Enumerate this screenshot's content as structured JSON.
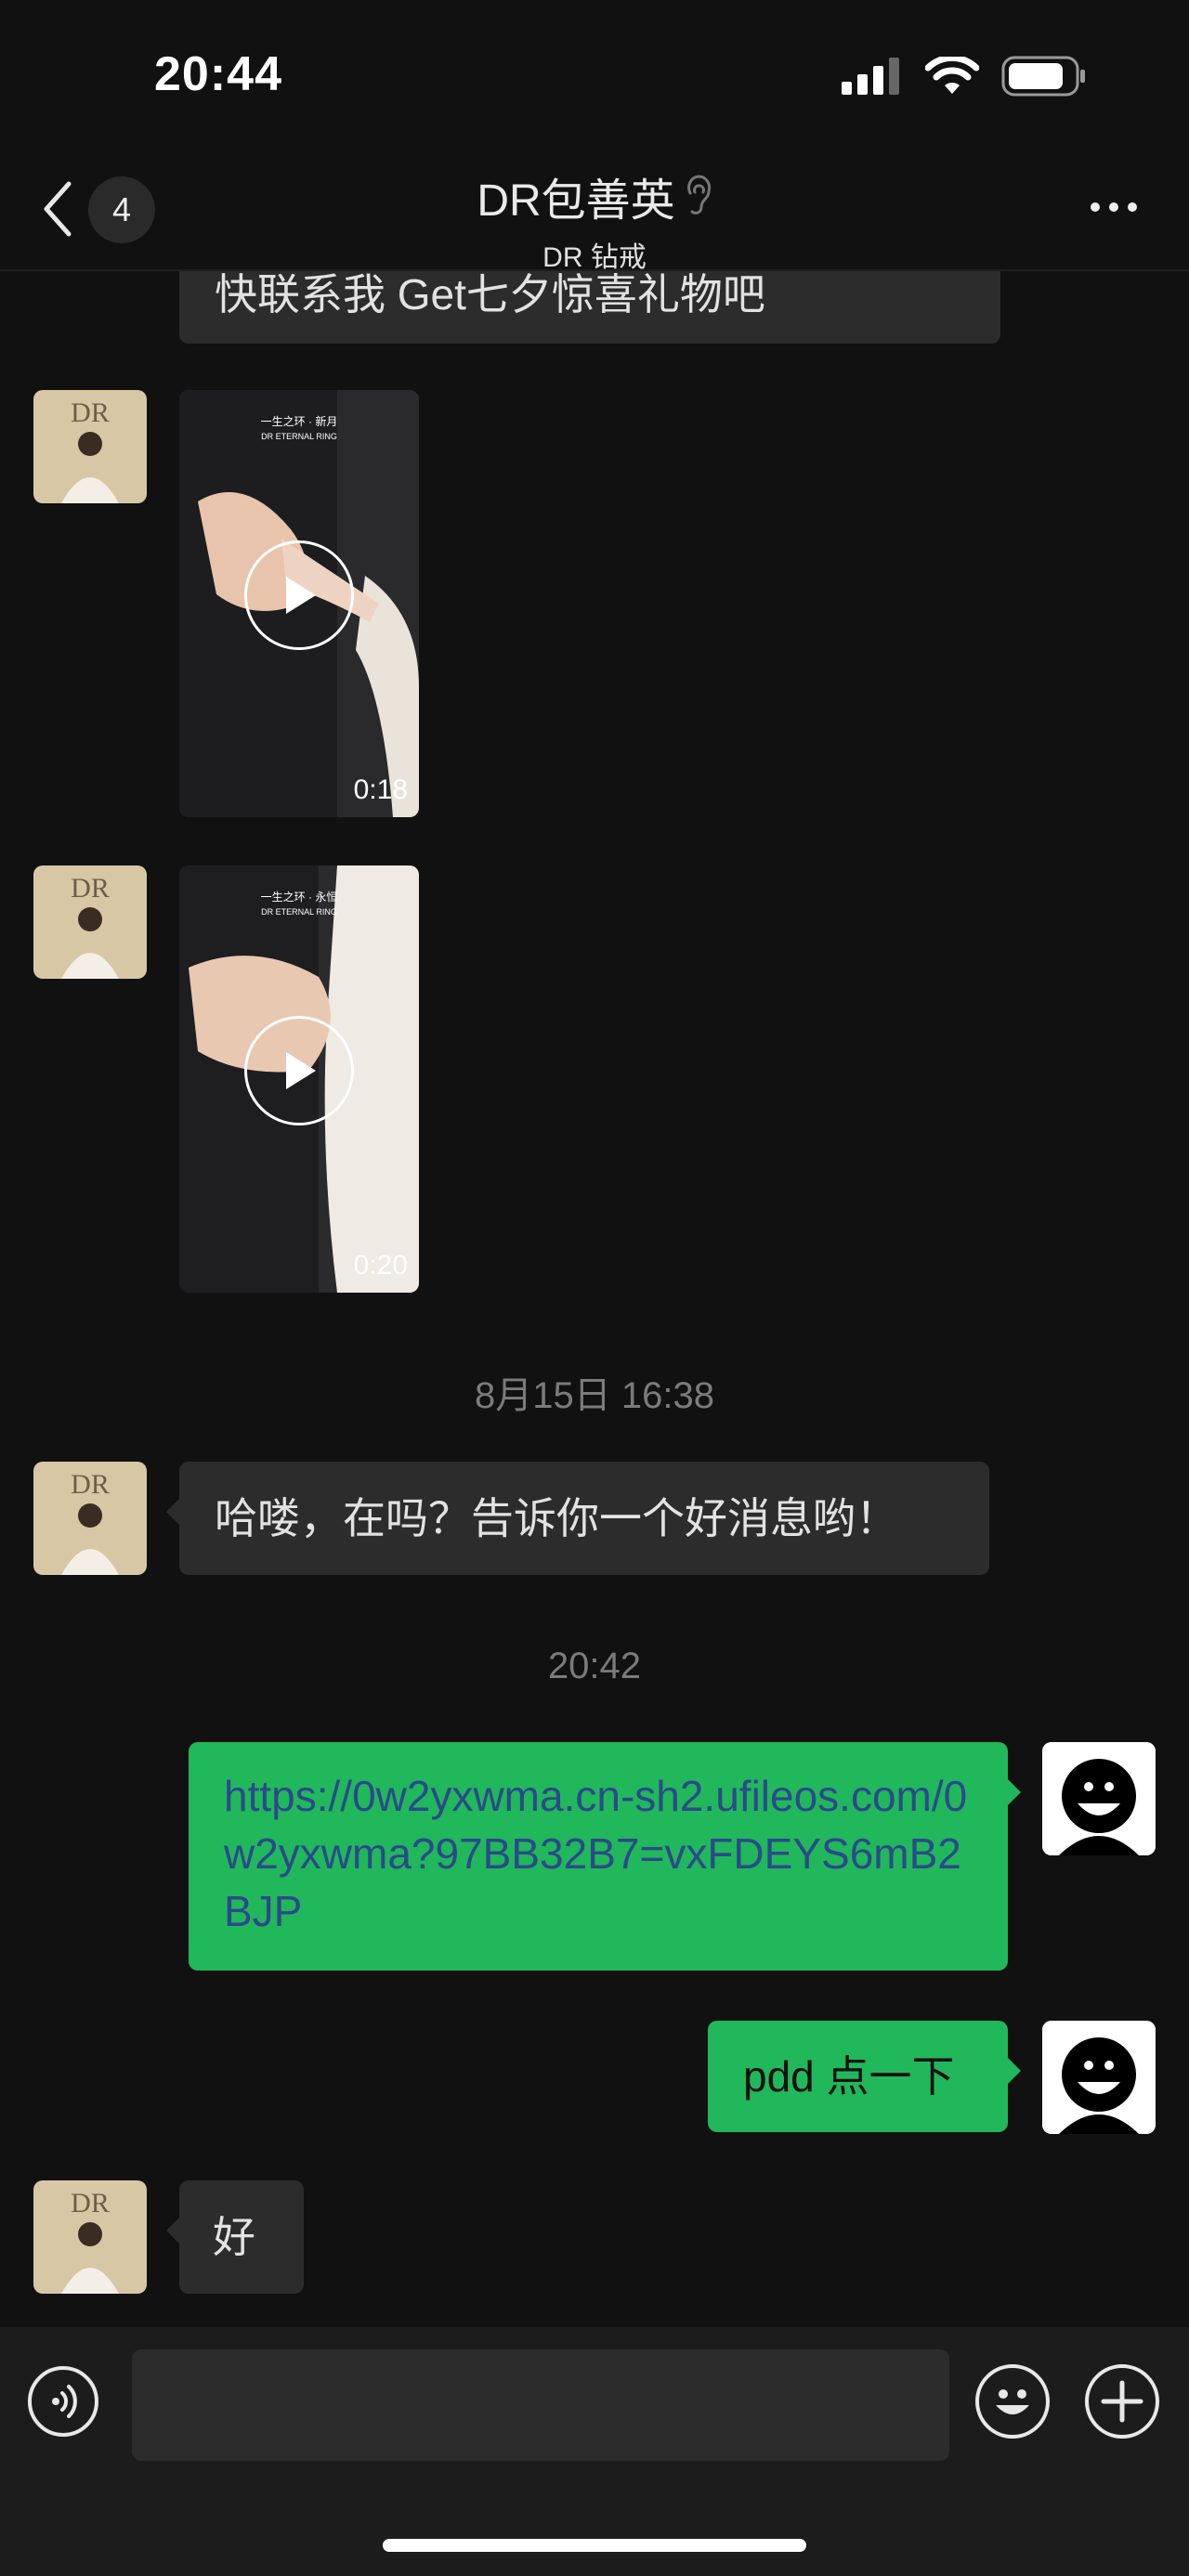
{
  "status_bar": {
    "time": "20:44"
  },
  "header": {
    "unread_count": "4",
    "title": "DR包善英",
    "subtitle": "DR 钻戒"
  },
  "messages": {
    "partial_text": "快联系我 Get七夕惊喜礼物吧",
    "video1": {
      "caption_line1": "一生之环 · 新月",
      "caption_line2": "DR ETERNAL RING",
      "duration": "0:18"
    },
    "video2": {
      "caption_line1": "一生之环 · 永恒",
      "caption_line2": "DR ETERNAL RING",
      "duration": "0:20"
    },
    "timestamp1": "8月15日 16:38",
    "greeting": "哈喽，在吗？告诉你一个好消息哟！",
    "timestamp2": "20:42",
    "link_text": "https://0w2yxwma.cn-sh2.ufileos.com/0w2yxwma?97BB32B7=vxFDEYS6mB2BJP",
    "reply": "pdd 点一下",
    "ok": "好"
  },
  "colors": {
    "accent_green": "#21b75b",
    "link_blue": "#2b4a8a",
    "background": "#111111",
    "bubble_gray": "#2c2c2c"
  },
  "icons": [
    "back-chevron-icon",
    "more-dots-icon",
    "voice-icon",
    "emoji-icon",
    "plus-icon",
    "play-icon",
    "signal-icon",
    "wifi-icon",
    "battery-icon"
  ]
}
